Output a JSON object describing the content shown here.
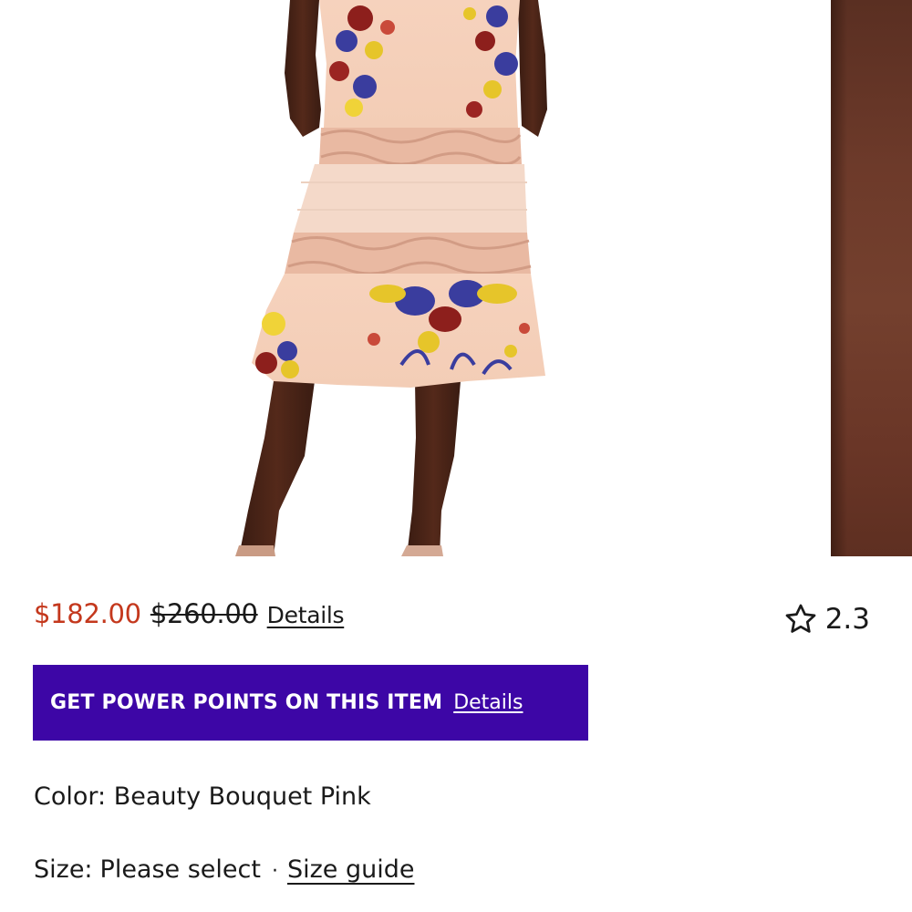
{
  "product": {
    "images": [
      {
        "label": "product-photo-main"
      },
      {
        "label": "product-photo-next"
      }
    ],
    "price": {
      "sale": "$182.00",
      "original": "$260.00",
      "details_link": "Details"
    },
    "rating": {
      "value": "2.3",
      "icon": "star-outline-icon"
    },
    "power_points": {
      "text": "GET POWER POINTS ON THIS ITEM",
      "details_link": "Details",
      "background_color": "#3d06a6"
    },
    "color": {
      "label": "Color:",
      "value": "Beauty Bouquet Pink"
    },
    "size": {
      "label": "Size:",
      "value": "Please select",
      "separator": "·",
      "guide_link": "Size guide"
    },
    "accent_colors": {
      "sale_price": "#c4381d",
      "text": "#1a1a1a"
    }
  }
}
